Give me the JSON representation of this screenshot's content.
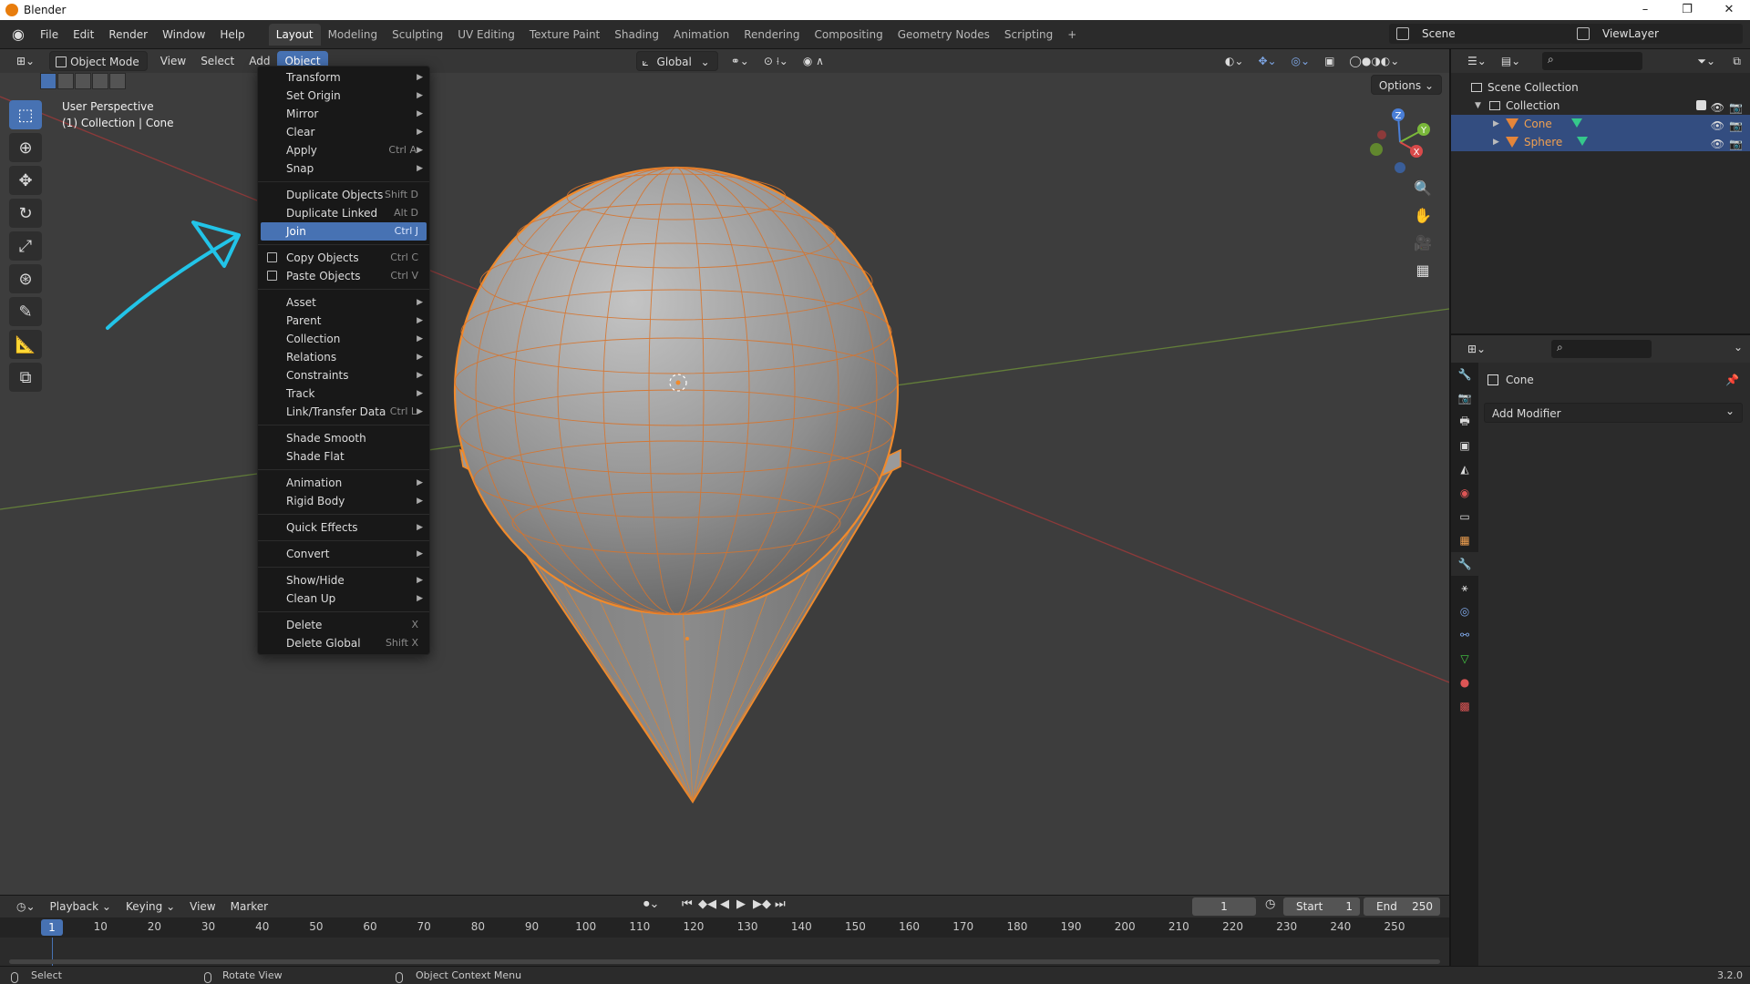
{
  "window": {
    "title": "Blender",
    "controls": [
      "–",
      "❐",
      "✕"
    ]
  },
  "topbar": {
    "menus": [
      "File",
      "Edit",
      "Render",
      "Window",
      "Help"
    ],
    "workspaces": [
      "Layout",
      "Modeling",
      "Sculpting",
      "UV Editing",
      "Texture Paint",
      "Shading",
      "Animation",
      "Rendering",
      "Compositing",
      "Geometry Nodes",
      "Scripting"
    ],
    "active_workspace": "Layout",
    "add_workspace": "+",
    "scene": "Scene",
    "view_layer": "ViewLayer"
  },
  "viewport": {
    "mode": "Object Mode",
    "menus": [
      "View",
      "Select",
      "Add",
      "Object"
    ],
    "active_menu": "Object",
    "transform_orientation": "Global",
    "options_label": "Options",
    "overlay_line1": "User Perspective",
    "overlay_line2": "(1) Collection | Cone",
    "gizmo_axes": [
      "Z",
      "Y",
      "X"
    ]
  },
  "object_menu": {
    "groups": [
      [
        {
          "label": "Transform",
          "shortcut": "",
          "submenu": true
        },
        {
          "label": "Set Origin",
          "shortcut": "",
          "submenu": true
        },
        {
          "label": "Mirror",
          "shortcut": "",
          "submenu": true
        },
        {
          "label": "Clear",
          "shortcut": "",
          "submenu": true
        },
        {
          "label": "Apply",
          "shortcut": "Ctrl A",
          "submenu": true
        },
        {
          "label": "Snap",
          "shortcut": "",
          "submenu": true
        }
      ],
      [
        {
          "label": "Duplicate Objects",
          "shortcut": "Shift D",
          "submenu": false
        },
        {
          "label": "Duplicate Linked",
          "shortcut": "Alt D",
          "submenu": false
        },
        {
          "label": "Join",
          "shortcut": "Ctrl J",
          "submenu": false,
          "highlighted": true
        }
      ],
      [
        {
          "label": "Copy Objects",
          "shortcut": "Ctrl C",
          "submenu": false,
          "icon": "copy-icon"
        },
        {
          "label": "Paste Objects",
          "shortcut": "Ctrl V",
          "submenu": false,
          "icon": "paste-icon"
        }
      ],
      [
        {
          "label": "Asset",
          "shortcut": "",
          "submenu": true
        },
        {
          "label": "Parent",
          "shortcut": "",
          "submenu": true
        },
        {
          "label": "Collection",
          "shortcut": "",
          "submenu": true
        },
        {
          "label": "Relations",
          "shortcut": "",
          "submenu": true
        },
        {
          "label": "Constraints",
          "shortcut": "",
          "submenu": true
        },
        {
          "label": "Track",
          "shortcut": "",
          "submenu": true
        },
        {
          "label": "Link/Transfer Data",
          "shortcut": "Ctrl L",
          "submenu": true
        }
      ],
      [
        {
          "label": "Shade Smooth",
          "shortcut": "",
          "submenu": false
        },
        {
          "label": "Shade Flat",
          "shortcut": "",
          "submenu": false
        }
      ],
      [
        {
          "label": "Animation",
          "shortcut": "",
          "submenu": true
        },
        {
          "label": "Rigid Body",
          "shortcut": "",
          "submenu": true
        }
      ],
      [
        {
          "label": "Quick Effects",
          "shortcut": "",
          "submenu": true
        }
      ],
      [
        {
          "label": "Convert",
          "shortcut": "",
          "submenu": true
        }
      ],
      [
        {
          "label": "Show/Hide",
          "shortcut": "",
          "submenu": true
        },
        {
          "label": "Clean Up",
          "shortcut": "",
          "submenu": true
        }
      ],
      [
        {
          "label": "Delete",
          "shortcut": "X",
          "submenu": false
        },
        {
          "label": "Delete Global",
          "shortcut": "Shift X",
          "submenu": false
        }
      ]
    ]
  },
  "outliner": {
    "root": "Scene Collection",
    "collection": "Collection",
    "objects": [
      {
        "name": "Cone",
        "selected": true
      },
      {
        "name": "Sphere",
        "selected": true
      }
    ]
  },
  "properties": {
    "object_name": "Cone",
    "add_modifier_label": "Add Modifier"
  },
  "timeline": {
    "menus": [
      "Playback",
      "Keying",
      "View",
      "Marker"
    ],
    "current_frame": "1",
    "start_label": "Start",
    "start_value": "1",
    "end_label": "End",
    "end_value": "250",
    "ticks": [
      "10",
      "20",
      "30",
      "40",
      "50",
      "60",
      "70",
      "80",
      "90",
      "100",
      "110",
      "120",
      "130",
      "140",
      "150",
      "160",
      "170",
      "180",
      "190",
      "200",
      "210",
      "220",
      "230",
      "240",
      "250"
    ]
  },
  "statusbar": {
    "left": "Select",
    "middle": "Rotate View",
    "right": "Object Context Menu",
    "version": "3.2.0"
  },
  "colors": {
    "accent": "#4772b3",
    "selection_outline": "#e8802c",
    "annotation_arrow": "#22c4e8"
  }
}
